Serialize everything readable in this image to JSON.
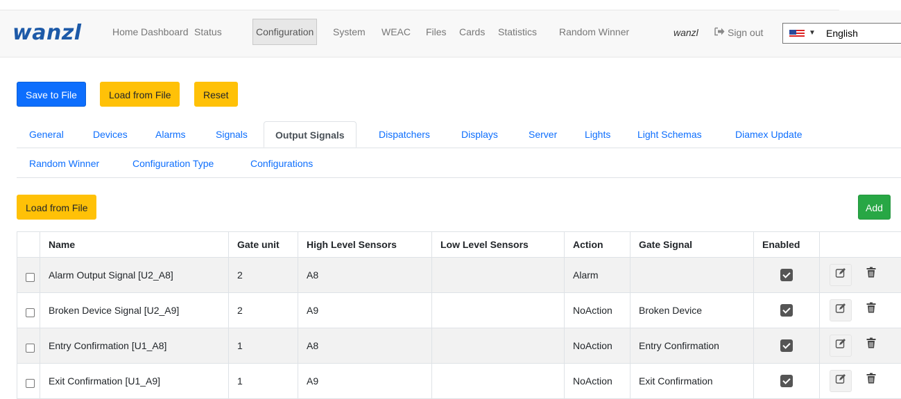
{
  "brand": {
    "logo_text": "wanzl"
  },
  "nav": {
    "items": [
      "Home",
      "Dashboard",
      "Status",
      "Configuration",
      "System",
      "WEAC",
      "Files",
      "Cards",
      "Statistics",
      "Random Winner"
    ],
    "active": "Configuration",
    "user": "wanzl",
    "sign_out": "Sign out",
    "language": "English"
  },
  "toolbar": {
    "save_label": "Save to File",
    "load_label": "Load from File",
    "reset_label": "Reset"
  },
  "tabs": {
    "row1": [
      "General",
      "Devices",
      "Alarms",
      "Signals",
      "Output Signals",
      "Dispatchers",
      "Displays",
      "Server",
      "Lights",
      "Light Schemas",
      "Diamex Update"
    ],
    "row2": [
      "Random Winner",
      "Configuration Type",
      "Configurations"
    ],
    "active": "Output Signals"
  },
  "section": {
    "load_label": "Load from File",
    "add_label": "Add"
  },
  "table": {
    "headers": [
      "Name",
      "Gate unit",
      "High Level Sensors",
      "Low Level Sensors",
      "Action",
      "Gate Signal",
      "Enabled"
    ],
    "rows": [
      {
        "name": "Alarm Output Signal [U2_A8]",
        "gate_unit": "2",
        "high": "A8",
        "low": "",
        "action": "Alarm",
        "gate_signal": "",
        "enabled": true
      },
      {
        "name": "Broken Device Signal [U2_A9]",
        "gate_unit": "2",
        "high": "A9",
        "low": "",
        "action": "NoAction",
        "gate_signal": "Broken Device",
        "enabled": true
      },
      {
        "name": "Entry Confirmation [U1_A8]",
        "gate_unit": "1",
        "high": "A8",
        "low": "",
        "action": "NoAction",
        "gate_signal": "Entry Confirmation",
        "enabled": true
      },
      {
        "name": "Exit Confirmation [U1_A9]",
        "gate_unit": "1",
        "high": "A9",
        "low": "",
        "action": "NoAction",
        "gate_signal": "Exit Confirmation",
        "enabled": true
      }
    ]
  },
  "icons": {
    "signout": "sign-in-arrow-icon",
    "edit": "pencil-square-icon",
    "delete": "trash-icon",
    "flag": "us-flag-icon",
    "checkbox": "checkbox-icon"
  },
  "colors": {
    "brand": "#1d5aa8",
    "primary": "#0d6efd",
    "warning": "#ffc107",
    "success": "#28a745"
  }
}
